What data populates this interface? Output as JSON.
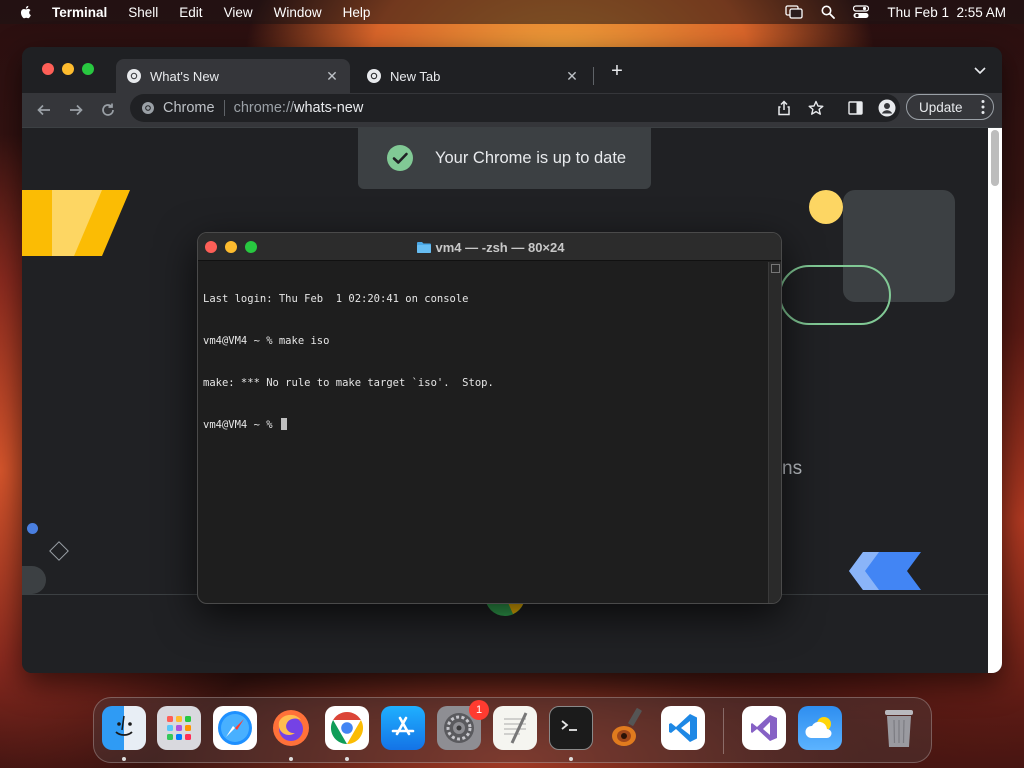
{
  "menubar": {
    "app_name": "Terminal",
    "items": [
      "Shell",
      "Edit",
      "View",
      "Window",
      "Help"
    ],
    "clock": "Thu Feb 1  2:55 AM"
  },
  "chrome": {
    "tabs": [
      {
        "title": "What's New",
        "active": true
      },
      {
        "title": "New Tab",
        "active": false
      }
    ],
    "omnibox": {
      "site_name": "Chrome",
      "url_scheme": "chrome://",
      "url_path": "whats-new"
    },
    "update_label": "Update",
    "toast_text": "Your Chrome is up to date",
    "partial_text": "ns"
  },
  "terminal": {
    "title": "vm4 — -zsh — 80×24",
    "lines": [
      "Last login: Thu Feb  1 02:20:41 on console",
      "vm4@VM4 ~ % make iso",
      "make: *** No rule to make target `iso'.  Stop.",
      "vm4@VM4 ~ % "
    ]
  },
  "dock": {
    "apps": [
      "Finder",
      "Launchpad",
      "Safari",
      "Firefox",
      "Google Chrome",
      "App Store",
      "System Settings",
      "TextEdit",
      "Terminal",
      "GarageBand",
      "Visual Studio Code",
      "Visual Studio",
      "Weather",
      "Trash"
    ],
    "settings_badge": "1"
  },
  "colors": {
    "chrome_bg": "#202124",
    "toolbar_bg": "#35363a",
    "toast_check": "#81c995",
    "terminal_bg": "#1e1e1e"
  }
}
